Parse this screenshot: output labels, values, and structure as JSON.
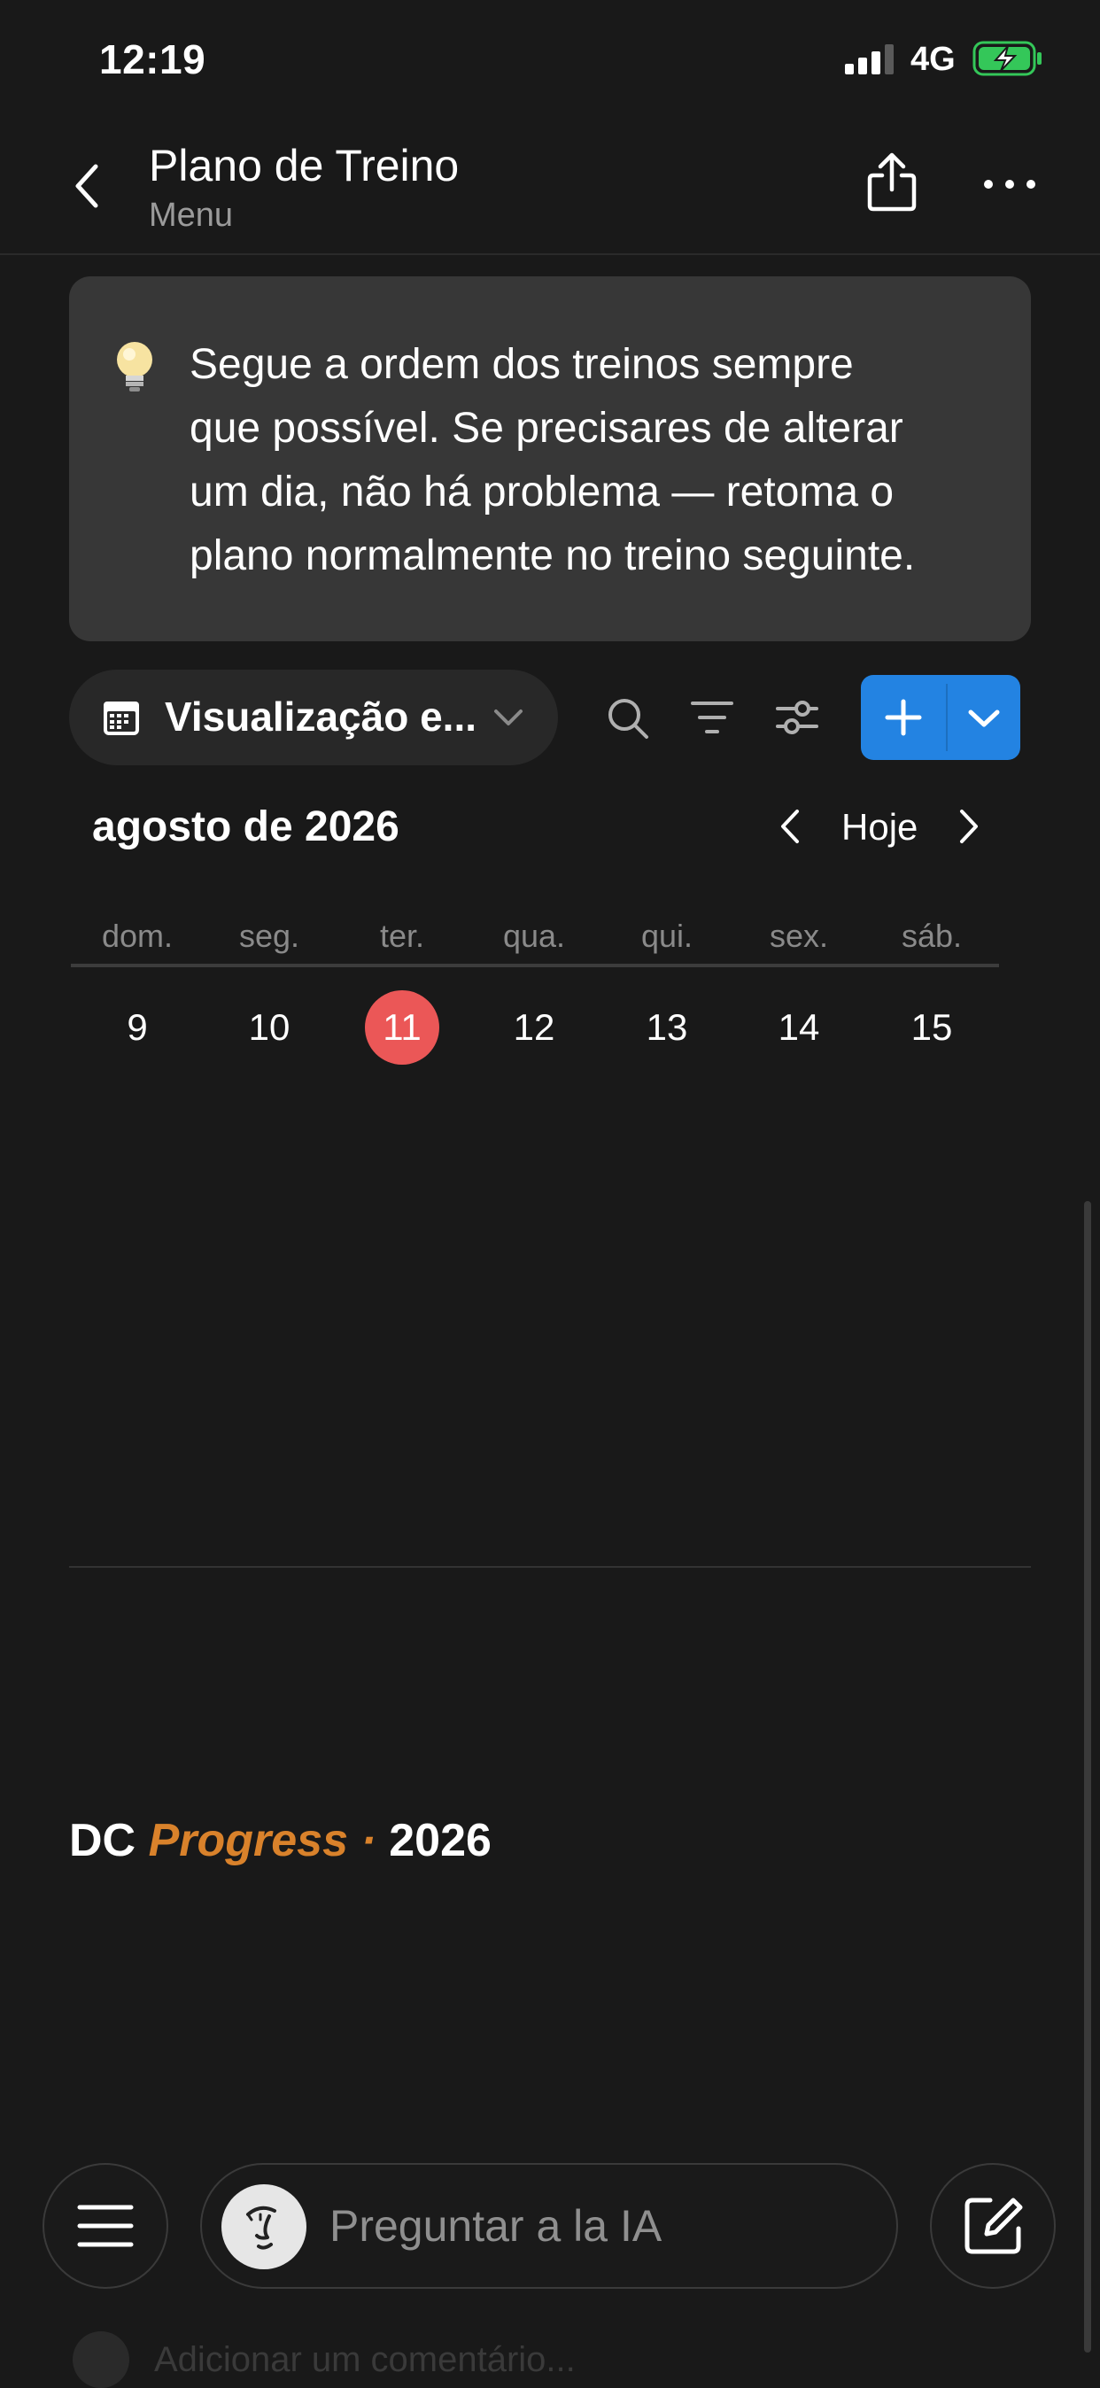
{
  "status_bar": {
    "time": "12:19",
    "network": "4G",
    "signal_icon": "signal-bars-icon",
    "battery_icon": "battery-charging-icon",
    "battery_color": "#34c759"
  },
  "header": {
    "title": "Plano de Treino",
    "subtitle": "Menu",
    "back_icon": "chevron-left-icon",
    "share_icon": "share-icon",
    "more_icon": "more-horizontal-icon"
  },
  "callout": {
    "icon": "lightbulb-icon",
    "lines": [
      "Segue a ordem dos treinos sempre",
      "que possível. Se precisares de alterar",
      "um dia, não há problema — retoma o",
      "plano normalmente no treino seguinte."
    ]
  },
  "toolbar": {
    "view_label": "Visualização e...",
    "view_icon": "calendar-icon",
    "search_icon": "search-icon",
    "filter_icon": "filter-icon",
    "settings_icon": "sliders-icon",
    "new_icon": "plus-icon",
    "new_dropdown_icon": "chevron-down-icon",
    "accent_color": "#2383e2"
  },
  "calendar": {
    "month_label": "agosto de 2026",
    "today_label": "Hoje",
    "weekdays": [
      "dom.",
      "seg.",
      "ter.",
      "qua.",
      "qui.",
      "sex.",
      "sáb."
    ],
    "days": [
      "9",
      "10",
      "11",
      "12",
      "13",
      "14",
      "15"
    ],
    "today_day": "11",
    "today_color": "#eb5757"
  },
  "footer": {
    "prefix": "DC",
    "accent": "Progress",
    "separator": "·",
    "year": "2026",
    "accent_color": "#d9822b"
  },
  "bottom_bar": {
    "menu_icon": "menu-icon",
    "ask_placeholder": "Preguntar a la IA",
    "ai_icon": "ai-face-icon",
    "compose_icon": "compose-icon"
  },
  "comment": {
    "placeholder": "Adicionar um comentário..."
  }
}
